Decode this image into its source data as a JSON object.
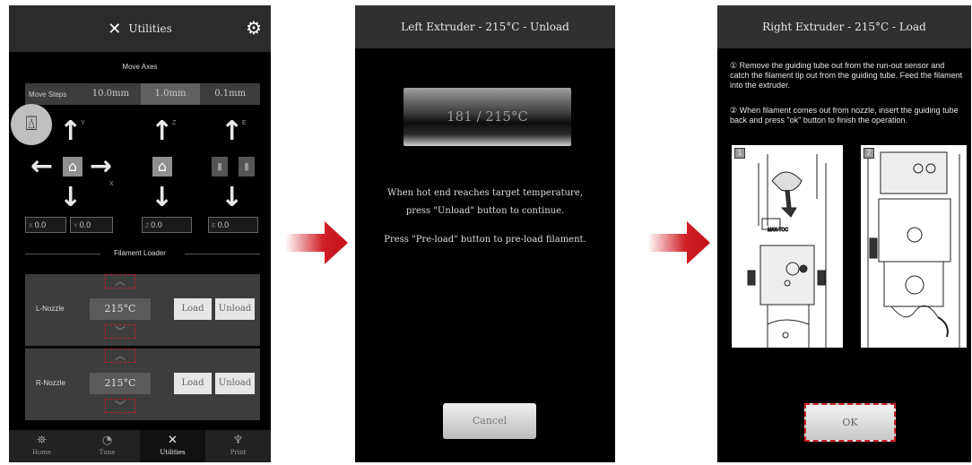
{
  "screen1": {
    "title": "Utilities",
    "title_icon": "wrench-screwdriver-icon",
    "settings_icon": "gear-icon",
    "move_axes": {
      "heading": "Move Axes",
      "steps_label": "Move Steps",
      "steps": [
        "10.0mm",
        "1.0mm",
        "0.1mm"
      ],
      "selected_step": "1.0mm",
      "markers": [
        "Y",
        "Z",
        "E",
        "X"
      ],
      "coords": [
        {
          "axis": "X",
          "value": "0.0"
        },
        {
          "axis": "Y",
          "value": "0.0"
        },
        {
          "axis": "Z",
          "value": "0.0"
        },
        {
          "axis": "E",
          "value": "0.0"
        }
      ]
    },
    "filament_loader": {
      "heading": "Filament Loader",
      "nozzles": [
        {
          "label": "L-Nozzle",
          "temp": "215°C",
          "load": "Load",
          "unload": "Unload"
        },
        {
          "label": "R-Nozzle",
          "temp": "215°C",
          "load": "Load",
          "unload": "Unload"
        }
      ]
    },
    "nav": [
      {
        "label": "Home",
        "icon": "home-icon"
      },
      {
        "label": "Tune",
        "icon": "tune-icon"
      },
      {
        "label": "Utilities",
        "icon": "utilities-icon",
        "active": true
      },
      {
        "label": "Print",
        "icon": "print-icon"
      }
    ]
  },
  "screen2": {
    "title": "Left Extruder - 215°C - Unload",
    "temperature": "181 / 215°C",
    "message_line1": "When hot end reaches target temperature,",
    "message_line2": "press \"Unload\" button to continue.",
    "message_line3": "Press \"Pre-load\" button to pre-load filament.",
    "cancel_label": "Cancel"
  },
  "screen3": {
    "title": "Right Extruder - 215°C - Load",
    "step1": "① Remove the guiding tube out from the run-out sensor and catch the filament tip out from the guiding tube. Feed the filament into the extruder.",
    "step2": "② When filament comes out from nozzle, insert the guiding tube back and press \"ok\" button to finish the operation.",
    "diagram_tags": [
      "1",
      "2"
    ],
    "ok_label": "OK"
  },
  "colors": {
    "accent_red": "#d0202a",
    "screen_bg": "#000000"
  }
}
